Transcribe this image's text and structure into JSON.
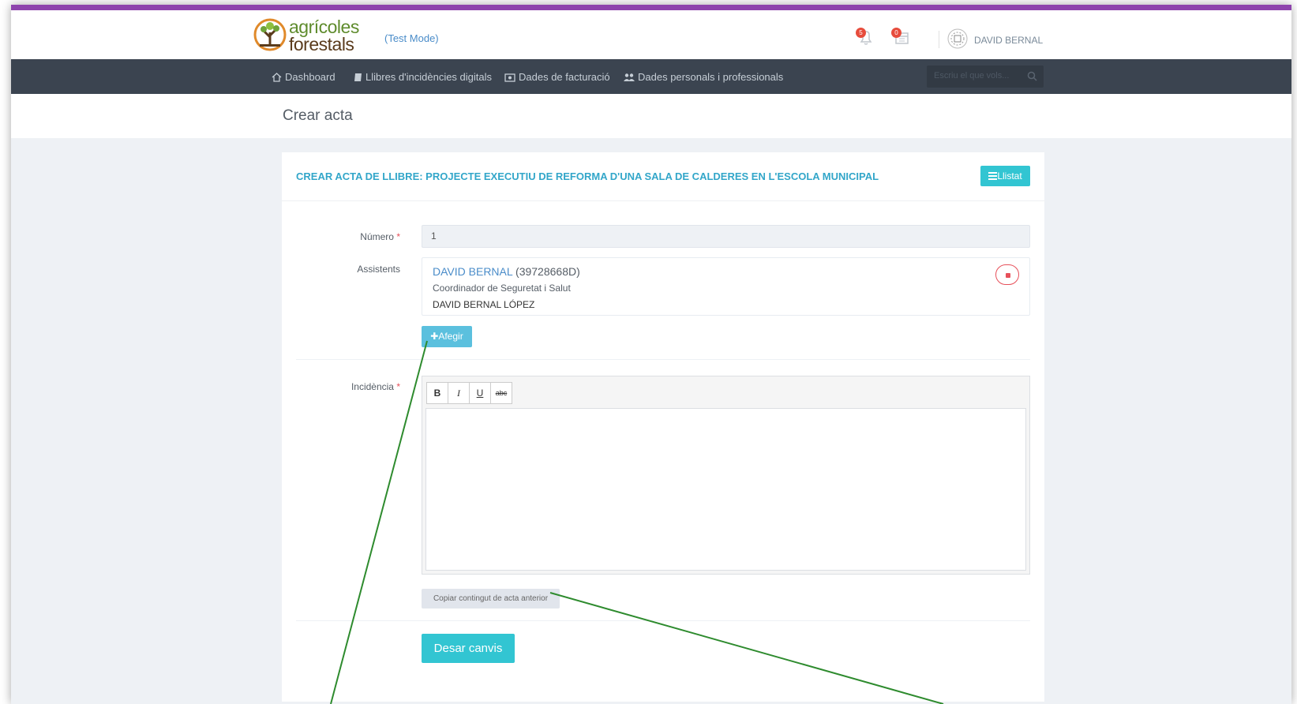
{
  "header": {
    "logo_line1": "agrícoles",
    "logo_line2": "forestals",
    "test_mode": "(Test Mode)",
    "notifications_count": "5",
    "tasks_count": "0",
    "username": "DAVID BERNAL"
  },
  "nav": {
    "items": [
      {
        "label": "Dashboard",
        "icon": "home-icon"
      },
      {
        "label": "Llibres d'incidències digitals",
        "icon": "book-icon"
      },
      {
        "label": "Dades de facturació",
        "icon": "money-icon"
      },
      {
        "label": "Dades personals i professionals",
        "icon": "users-icon"
      }
    ],
    "search_placeholder": "Escriu el que vols..."
  },
  "page": {
    "title": "Crear acta"
  },
  "card": {
    "title": "CREAR ACTA DE LLIBRE: PROJECTE EXECUTIU DE REFORMA D'UNA SALA DE CALDERES EN L'ESCOLA MUNICIPAL",
    "list_button": "Llistat"
  },
  "form": {
    "numero_label": "Número",
    "numero_value": "1",
    "assistents_label": "Assistents",
    "assistant": {
      "name": "DAVID BERNAL",
      "id": "(39728668D)",
      "role": "Coordinador de Seguretat i Salut",
      "full_name": "DAVID BERNAL LÓPEZ"
    },
    "add_button": "Afegir",
    "incidencia_label": "Incidència",
    "editor_buttons": [
      "B",
      "I",
      "U",
      "abc"
    ],
    "copy_button": "Copiar contingut de acta anterior",
    "save_button": "Desar canvis"
  },
  "colors": {
    "accent": "#32c5d2",
    "title": "#32a6c9",
    "navbar": "#3b4450",
    "top_stripe": "#8e44ad",
    "danger": "#e7505a"
  }
}
